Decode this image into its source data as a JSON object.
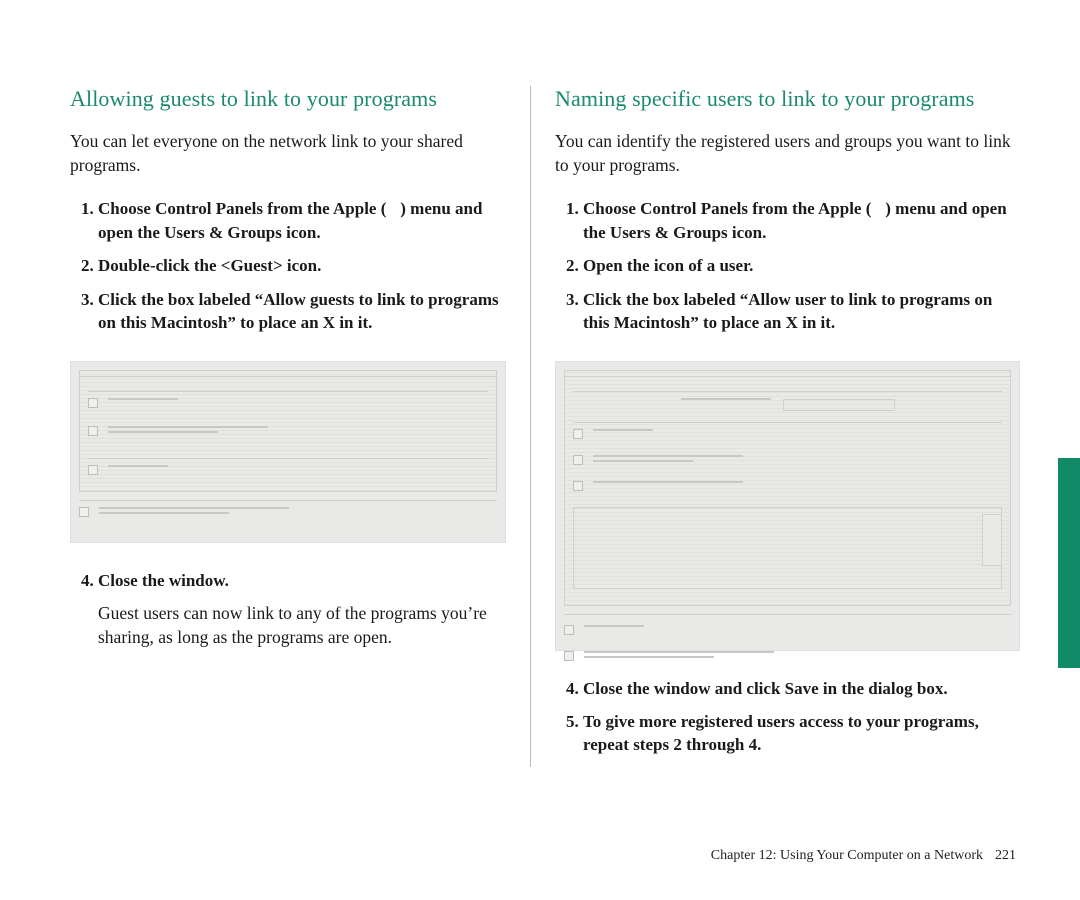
{
  "accent_color": "#1a8a6e",
  "apple_glyph": "",
  "left": {
    "heading": "Allowing guests to link to your programs",
    "intro": "You can let everyone on the network link to your shared programs.",
    "steps": {
      "s1a": "Choose Control Panels from the Apple (",
      "s1b": ") menu and open the Users & Groups icon.",
      "s2": "Double-click the <Guest> icon.",
      "s3": "Click the box labeled “Allow guests to link to programs on this Macintosh” to place an X in it.",
      "s4": "Close the window."
    },
    "after_step4": "Guest users can now link to any of the programs you’re sharing, as long as the programs are open."
  },
  "right": {
    "heading": "Naming specific users to link to your programs",
    "intro": "You can identify the registered users and groups you want to link to your programs.",
    "steps": {
      "s1a": "Choose Control Panels from the Apple (",
      "s1b": ") menu and open the Users & Groups icon.",
      "s2": "Open the icon of a user.",
      "s3": "Click the box labeled “Allow user to link to programs on this Macintosh” to place an X in it.",
      "s4": "Close the window and click Save in the dialog box.",
      "s5": "To give more registered users access to your programs, repeat steps 2 through 4."
    }
  },
  "footer": {
    "chapter_label": "Chapter 12: Using Your Computer on a Network",
    "page_number": "221"
  }
}
